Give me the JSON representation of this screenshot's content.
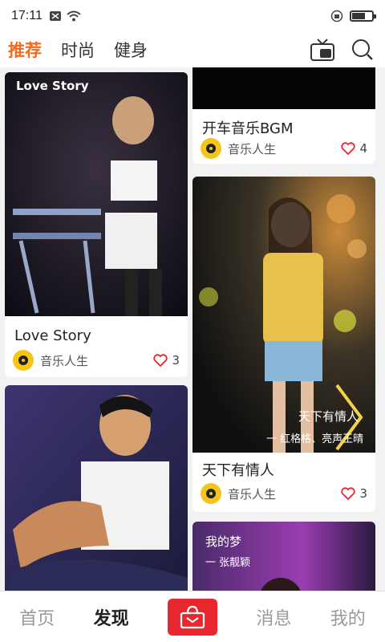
{
  "status": {
    "time": "17:11"
  },
  "tabs": [
    {
      "label": "推荐",
      "active": true
    },
    {
      "label": "时尚",
      "active": false
    },
    {
      "label": "健身",
      "active": false
    }
  ],
  "colors": {
    "accent": "#f36a1f",
    "center_button": "#e8272e"
  },
  "cards": [
    {
      "overlay_title": "Love Story",
      "caption": "Love Story",
      "author": "音乐人生",
      "likes": "3"
    },
    {
      "caption": "开车音乐BGM",
      "author": "音乐人生",
      "likes": "4"
    },
    {
      "overlay_title": "天下有情人",
      "overlay_sub": "一 红格格、亮声王晴",
      "caption": "天下有情人",
      "author": "音乐人生",
      "likes": "3"
    },
    {},
    {
      "overlay_title": "我的梦",
      "overlay_sub": "一 张靓颖"
    }
  ],
  "bottom_nav": [
    {
      "label": "首页",
      "active": false
    },
    {
      "label": "发现",
      "active": true
    },
    {
      "label": "消息",
      "active": false
    },
    {
      "label": "我的",
      "active": false
    }
  ]
}
